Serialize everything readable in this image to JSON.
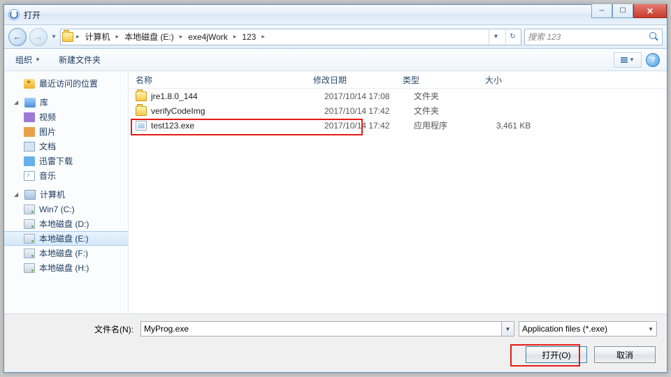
{
  "window": {
    "title": "打开"
  },
  "breadcrumb": {
    "root_icon": "folder",
    "items": [
      "计算机",
      "本地磁盘 (E:)",
      "exe4jWork",
      "123"
    ]
  },
  "search": {
    "placeholder": "搜索 123"
  },
  "toolbar": {
    "organize": "组织",
    "new_folder": "新建文件夹"
  },
  "sidebar": {
    "favorites_label": "最近访问的位置",
    "library_label": "库",
    "library_items": [
      {
        "label": "视频",
        "icon": "vid"
      },
      {
        "label": "图片",
        "icon": "pic"
      },
      {
        "label": "文档",
        "icon": "doc"
      },
      {
        "label": "迅雷下载",
        "icon": "dl"
      },
      {
        "label": "音乐",
        "icon": "mus"
      }
    ],
    "computer_label": "计算机",
    "drives": [
      {
        "label": "Win7 (C:)",
        "selected": false
      },
      {
        "label": "本地磁盘 (D:)",
        "selected": false
      },
      {
        "label": "本地磁盘 (E:)",
        "selected": true
      },
      {
        "label": "本地磁盘 (F:)",
        "selected": false
      },
      {
        "label": "本地磁盘 (H:)",
        "selected": false
      }
    ]
  },
  "columns": {
    "name": "名称",
    "date": "修改日期",
    "type": "类型",
    "size": "大小"
  },
  "files": [
    {
      "name": "jre1.8.0_144",
      "date": "2017/10/14 17:08",
      "type": "文件夹",
      "size": "",
      "icon": "folder"
    },
    {
      "name": "verifyCodeImg",
      "date": "2017/10/14 17:42",
      "type": "文件夹",
      "size": "",
      "icon": "folder"
    },
    {
      "name": "test123.exe",
      "date": "2017/10/14 17:42",
      "type": "应用程序",
      "size": "3,461 KB",
      "icon": "exe",
      "highlighted": true
    }
  ],
  "footer": {
    "filename_label": "文件名(N):",
    "filename_value": "MyProg.exe",
    "filter_label": "Application files (*.exe)",
    "open_label": "打开(O)",
    "cancel_label": "取消"
  }
}
